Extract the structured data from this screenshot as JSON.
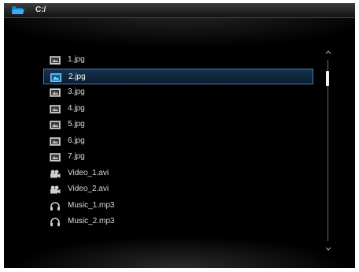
{
  "header": {
    "path": "C:/",
    "folder_icon": "folder-icon"
  },
  "file_list": {
    "items": [
      {
        "label": "1.jpg",
        "icon": "image-icon",
        "selected": false
      },
      {
        "label": "2.jpg",
        "icon": "image-icon",
        "selected": true
      },
      {
        "label": "3.jpg",
        "icon": "image-icon",
        "selected": false
      },
      {
        "label": "4.jpg",
        "icon": "image-icon",
        "selected": false
      },
      {
        "label": "5.jpg",
        "icon": "image-icon",
        "selected": false
      },
      {
        "label": "6.jpg",
        "icon": "image-icon",
        "selected": false
      },
      {
        "label": "7.jpg",
        "icon": "image-icon",
        "selected": false
      },
      {
        "label": "Video_1.avi",
        "icon": "video-icon",
        "selected": false
      },
      {
        "label": "Video_2.avi",
        "icon": "video-icon",
        "selected": false
      },
      {
        "label": "Music_1.mp3",
        "icon": "headphones-icon",
        "selected": false
      },
      {
        "label": "Music_2.mp3",
        "icon": "headphones-icon",
        "selected": false
      }
    ]
  },
  "colors": {
    "background": "#000000",
    "selection_border": "#3f7fb3",
    "selection_fill": "#17334d",
    "folder_accent": "#2a9ee6"
  }
}
